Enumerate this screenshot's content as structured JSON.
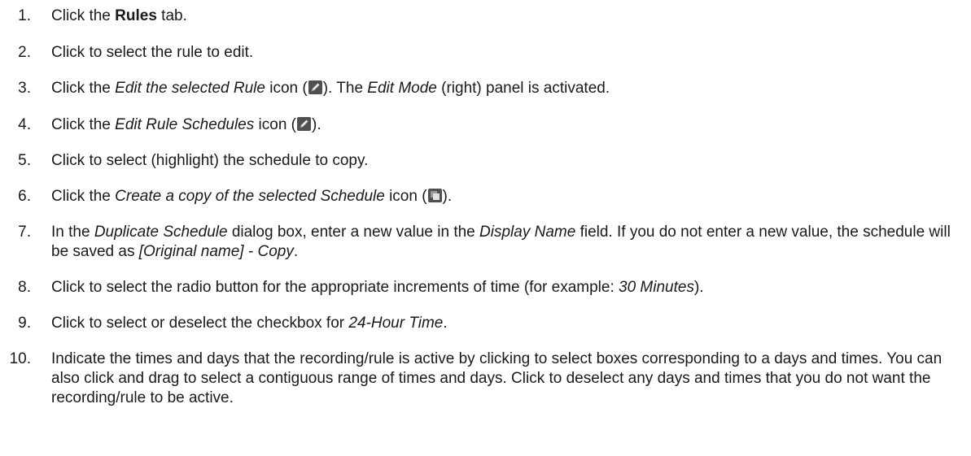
{
  "steps": [
    {
      "number": "1.",
      "parts": [
        {
          "t": "Click the "
        },
        {
          "t": "Rules",
          "s": "b"
        },
        {
          "t": " tab."
        }
      ]
    },
    {
      "number": "2.",
      "parts": [
        {
          "t": "Click to select the rule to edit."
        }
      ]
    },
    {
      "number": "3.",
      "parts": [
        {
          "t": "Click the "
        },
        {
          "t": "Edit the selected Rule",
          "s": "i"
        },
        {
          "t": " icon ("
        },
        {
          "icon": "pencil-icon"
        },
        {
          "t": "). The "
        },
        {
          "t": "Edit Mode",
          "s": "i"
        },
        {
          "t": " (right) panel is activated."
        }
      ]
    },
    {
      "number": "4.",
      "parts": [
        {
          "t": "Click the "
        },
        {
          "t": "Edit Rule Schedules",
          "s": "i"
        },
        {
          "t": " icon ("
        },
        {
          "icon": "pencil-icon"
        },
        {
          "t": ")."
        }
      ]
    },
    {
      "number": "5.",
      "parts": [
        {
          "t": "Click to select (highlight) the schedule to copy."
        }
      ]
    },
    {
      "number": "6.",
      "parts": [
        {
          "t": "Click the "
        },
        {
          "t": "Create a copy of the selected Schedule",
          "s": "i"
        },
        {
          "t": " icon ("
        },
        {
          "icon": "copy-icon"
        },
        {
          "t": ")."
        }
      ]
    },
    {
      "number": "7.",
      "parts": [
        {
          "t": "In the "
        },
        {
          "t": "Duplicate Schedule",
          "s": "i"
        },
        {
          "t": " dialog box, enter a new value in the "
        },
        {
          "t": "Display Name",
          "s": "i"
        },
        {
          "t": " field. If you do not enter a new value, the schedule will be saved as "
        },
        {
          "t": "[Original name] - Copy",
          "s": "i"
        },
        {
          "t": "."
        }
      ]
    },
    {
      "number": "8.",
      "parts": [
        {
          "t": "Click to select the radio button for the appropriate increments of time (for example: "
        },
        {
          "t": "30 Minutes",
          "s": "i"
        },
        {
          "t": ")."
        }
      ]
    },
    {
      "number": "9.",
      "parts": [
        {
          "t": "Click to select or deselect the checkbox for "
        },
        {
          "t": "24-Hour Time",
          "s": "i"
        },
        {
          "t": "."
        }
      ]
    },
    {
      "number": "10.",
      "parts": [
        {
          "t": "Indicate the times and days that the recording/rule is active by clicking to select boxes corresponding to a days and times. You can also click and drag to select a contiguous range of times and days. Click to deselect any days and times that you do not want the recording/rule to be active."
        }
      ]
    }
  ]
}
